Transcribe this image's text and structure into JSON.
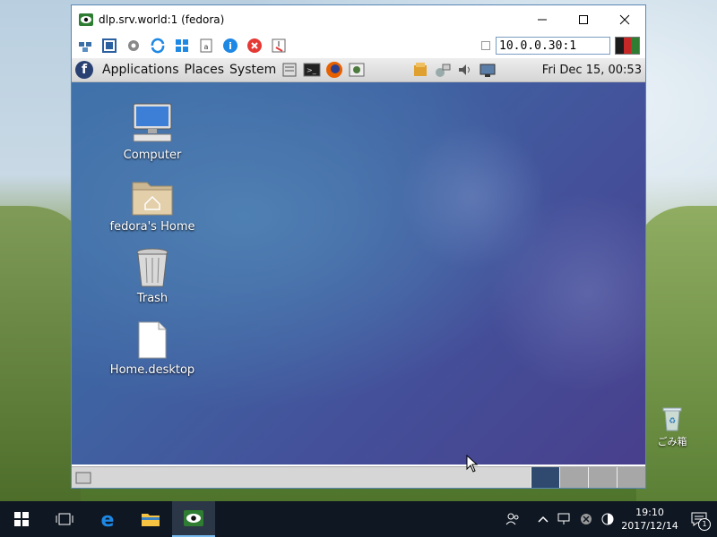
{
  "window": {
    "title": "dlp.srv.world:1 (fedora)",
    "address": "10.0.0.30:1"
  },
  "toolbar_icons": [
    "connection-options-icon",
    "fullscreen-icon",
    "settings-icon",
    "refresh-icon",
    "windows-key-icon",
    "ctrl-alt-del-icon",
    "info-icon",
    "disconnect-icon",
    "transfer-icon"
  ],
  "fedora_panel": {
    "menus": [
      "Applications",
      "Places",
      "System"
    ],
    "clock": "Fri Dec 15, 00:53"
  },
  "fedora_desktop": {
    "icons": [
      {
        "label": "Computer"
      },
      {
        "label": "fedora's Home"
      },
      {
        "label": "Trash"
      },
      {
        "label": "Home.desktop"
      }
    ]
  },
  "windows_desktop": {
    "recycle_bin_label": "ごみ箱"
  },
  "taskbar": {
    "time": "19:10",
    "date": "2017/12/14",
    "notification_count": "1"
  },
  "colors": {
    "accent": "#0078d7",
    "fedora_blue": "#294172"
  }
}
